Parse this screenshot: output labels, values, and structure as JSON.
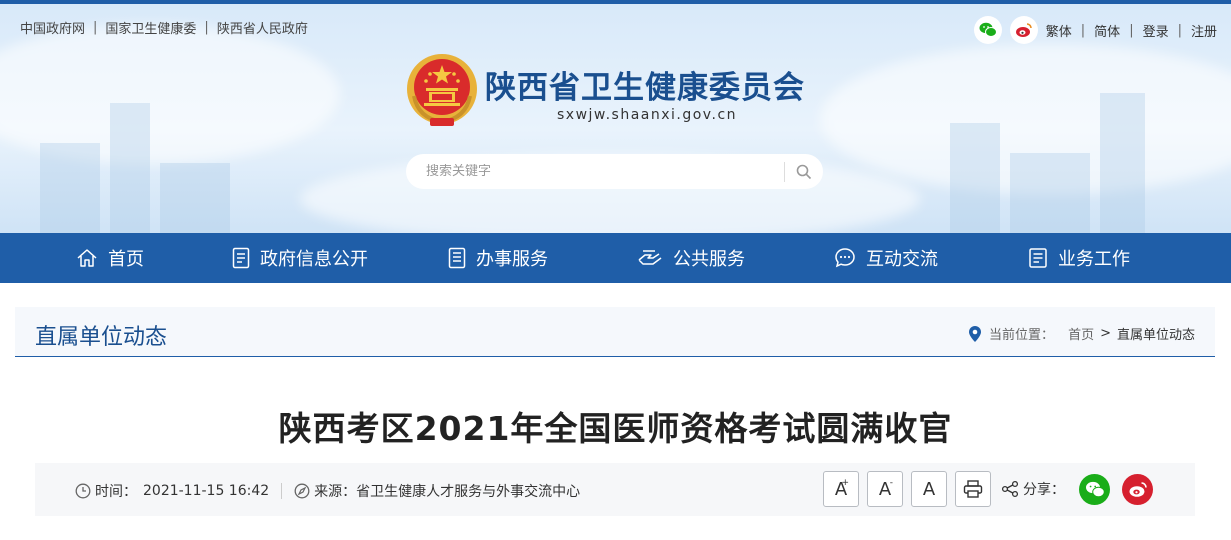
{
  "top_links": [
    "中国政府网",
    "国家卫生健康委",
    "陕西省人民政府"
  ],
  "top_right": {
    "traditional": "繁体",
    "simplified": "简体",
    "login": "登录",
    "register": "注册"
  },
  "site": {
    "title": "陕西省卫生健康委员会",
    "domain": "sxwjw.shaanxi.gov.cn"
  },
  "search": {
    "placeholder": "搜索关键字"
  },
  "nav": [
    "首页",
    "政府信息公开",
    "办事服务",
    "公共服务",
    "互动交流",
    "业务工作"
  ],
  "section": {
    "title": "直属单位动态"
  },
  "breadcrumb": {
    "label": "当前位置：",
    "home": "首页",
    "separator": ">",
    "current": "直属单位动态"
  },
  "article": {
    "title": "陕西考区2021年全国医师资格考试圆满收官",
    "time_label": "时间：",
    "time": "2021-11-15 16:42",
    "source_label": "来源：",
    "source": "省卫生健康人才服务与外事交流中心"
  },
  "tools": {
    "font_large": "A",
    "font_small": "A",
    "font_normal": "A",
    "share_label": "分享："
  },
  "colors": {
    "primary": "#1f5ea8",
    "wechat": "#1aad19",
    "weibo": "#d6202f"
  }
}
